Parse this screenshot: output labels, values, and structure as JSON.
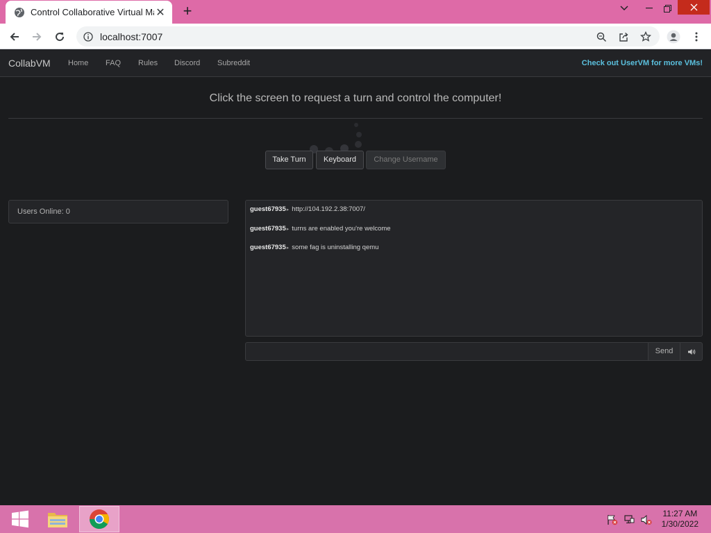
{
  "browser": {
    "tab_title": "Control Collaborative Virtual Ma",
    "new_tab": "+",
    "url": "localhost:7007"
  },
  "navbar": {
    "brand": "CollabVM",
    "links": [
      "Home",
      "FAQ",
      "Rules",
      "Discord",
      "Subreddit"
    ],
    "promo": "Check out UserVM for more VMs!"
  },
  "main": {
    "heading": "Click the screen to request a turn and control the computer!",
    "buttons": {
      "take_turn": "Take Turn",
      "keyboard": "Keyboard",
      "change_username": "Change Username"
    }
  },
  "users": {
    "online_label": "Users Online: 0"
  },
  "chat": {
    "messages": [
      {
        "user": "guest67935",
        "text": "http://104.192.2.38:7007/"
      },
      {
        "user": "guest67935",
        "text": "turns are enabled you're welcome"
      },
      {
        "user": "guest67935",
        "text": "some fag is uninstalling qemu"
      }
    ],
    "input_value": "",
    "send_label": "Send"
  },
  "taskbar": {
    "time": "11:27 AM",
    "date": "1/30/2022"
  },
  "colors": {
    "browser_frame": "#de6aa7",
    "taskbar": "#d872ab",
    "page_bg": "#1b1c1e",
    "link_accent": "#5bc0de"
  }
}
